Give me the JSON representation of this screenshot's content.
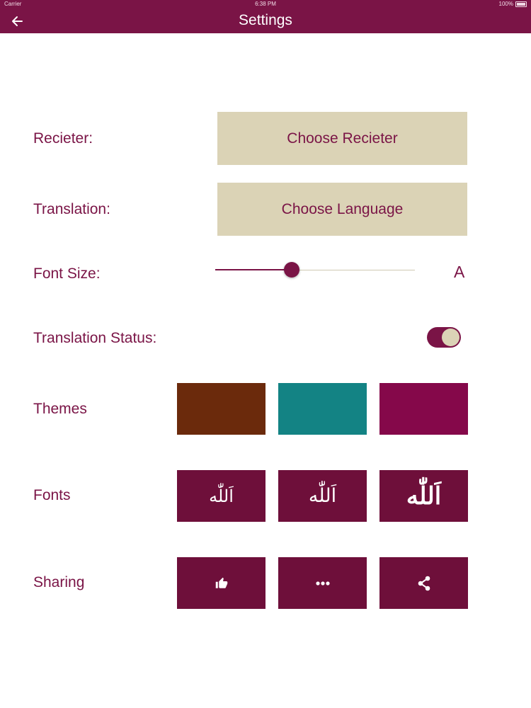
{
  "status_bar": {
    "carrier": "Carrier",
    "time": "6:38 PM",
    "battery": "100%"
  },
  "nav": {
    "title": "Settings",
    "back_icon": "arrow-left-icon"
  },
  "reciter": {
    "label": "Recieter:",
    "button": "Choose Recieter"
  },
  "translation": {
    "label": "Translation:",
    "button": "Choose Language"
  },
  "font_size": {
    "label": "Font Size:",
    "indicator": "A",
    "value_fraction": 0.38
  },
  "translation_status": {
    "label": "Translation Status:",
    "enabled": true
  },
  "themes": {
    "label": "Themes",
    "colors": [
      "#6b2a0c",
      "#138384",
      "#85084a"
    ]
  },
  "fonts": {
    "label": "Fonts",
    "samples": [
      "اَللّٰه",
      "اَللّٰه",
      "اَللّٰه"
    ]
  },
  "sharing": {
    "label": "Sharing",
    "icons": [
      "thumbs-up-icon",
      "more-dots-icon",
      "share-icon"
    ]
  },
  "colors": {
    "primary": "#7a1446",
    "button_bg": "#dbd3b6",
    "tile_bg": "#6e0f3a"
  }
}
